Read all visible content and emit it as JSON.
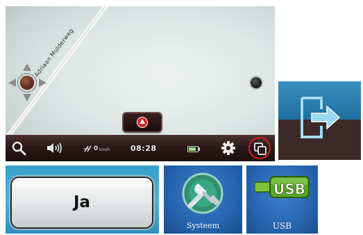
{
  "map": {
    "street_name": "Adriaan Mulderweg"
  },
  "status_bar": {
    "speed_value": "0",
    "speed_unit": "km/h",
    "clock": "08:28"
  },
  "dialog": {
    "confirm_label": "Ja"
  },
  "settings_menu": {
    "systeem_label": "Systeem",
    "usb_label": "USB",
    "usb_icon_text": "USB"
  },
  "colors": {
    "accent_red": "#d42020",
    "bar_brown": "#2b1919",
    "menu_blue": "#2563ad",
    "usb_green": "#5aa82a"
  },
  "icons": [
    "search-icon",
    "volume-icon",
    "speed-icon",
    "battery-icon",
    "gear-icon",
    "windows-icon",
    "exit-icon",
    "systeem-icon",
    "usb-icon"
  ]
}
